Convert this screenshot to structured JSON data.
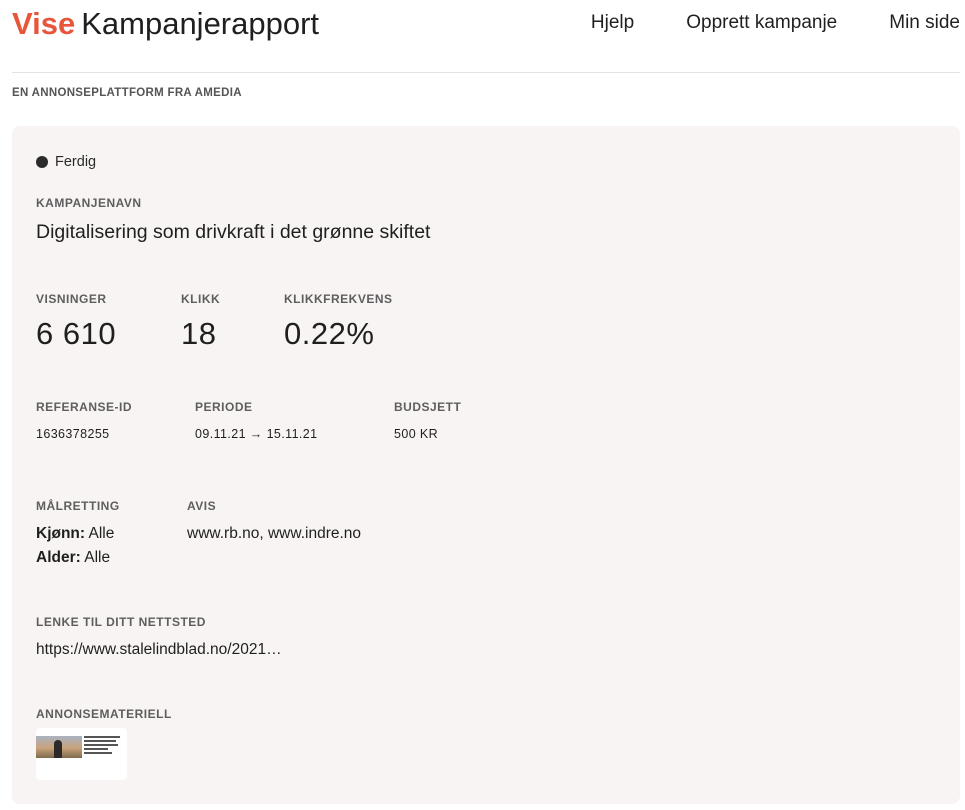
{
  "header": {
    "brand": "Vise",
    "title": "Kampanjerapport",
    "nav": [
      "Hjelp",
      "Opprett kampanje",
      "Min side"
    ]
  },
  "tagline": "EN ANNONSEPLATTFORM FRA AMEDIA",
  "campaign": {
    "status": "Ferdig",
    "name_label": "KAMPANJENAVN",
    "name": "Digitalisering som drivkraft i det grønne skiftet",
    "stats": [
      {
        "label": "VISNINGER",
        "value": "6 610"
      },
      {
        "label": "KLIKK",
        "value": "18"
      },
      {
        "label": "KLIKKFREKVENS",
        "value": "0.22%"
      }
    ],
    "details": [
      {
        "label": "REFERANSE-ID",
        "value": "1636378255"
      },
      {
        "label": "PERIODE",
        "value": "09.11.21 → 15.11.21"
      },
      {
        "label": "BUDSJETT",
        "value": "500 KR"
      }
    ],
    "targeting": {
      "label": "MÅLRETTING",
      "gender_key": "Kjønn:",
      "gender_value": " Alle",
      "age_key": "Alder:",
      "age_value": " Alle"
    },
    "newspaper": {
      "label": "AVIS",
      "value": "www.rb.no, www.indre.no"
    },
    "link": {
      "label": "LENKE TIL DITT NETTSTED",
      "value": "https://www.stalelindblad.no/2021…"
    },
    "material": {
      "label": "ANNONSEMATERIELL"
    }
  },
  "colors": {
    "brand": "#e8553a",
    "card_bg": "#f8f4f3",
    "status_dot": "#2b2b2b"
  }
}
